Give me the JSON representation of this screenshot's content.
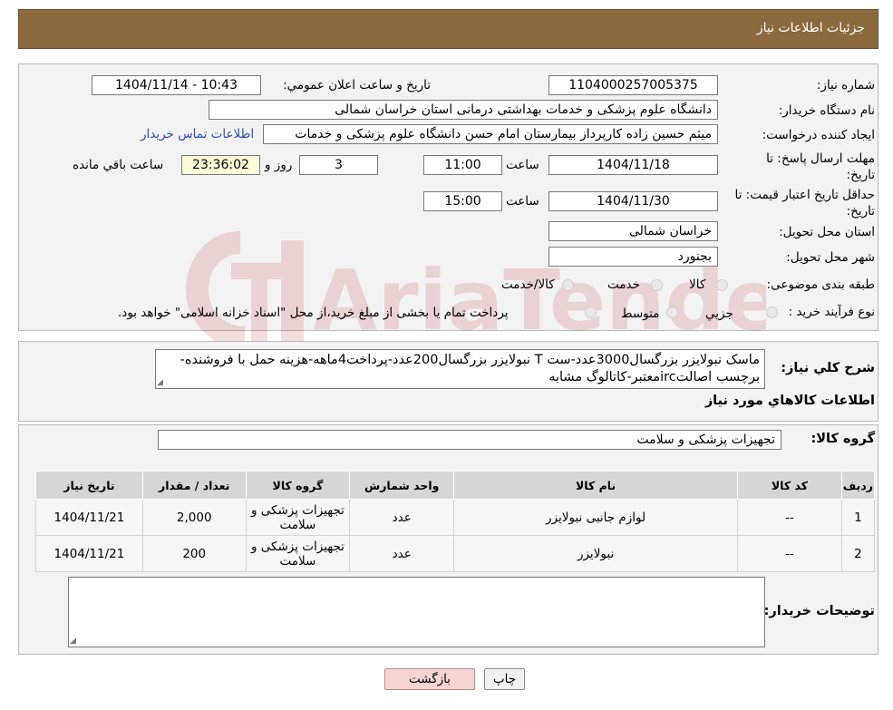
{
  "header": {
    "title": "جزئیات اطلاعات نیاز"
  },
  "form": {
    "need_number_label": "شماره نیاز:",
    "need_number": "1104000257005375",
    "announce_label": "تاریخ و ساعت اعلان عمومي:",
    "announce_value": "1404/11/14 - 10:43",
    "buyer_org_label": "نام دستگاه خريدار:",
    "buyer_org": "دانشگاه علوم پزشکی و خدمات بهداشتی درمانی استان خراسان شمالی",
    "requester_label": "ايجاد کننده درخواست:",
    "requester": "میثم  حسین زاده  کارپرداز بیمارستان امام حسن دانشگاه علوم پزشکی و خدمات",
    "contact_link": "اطلاعات تماس خريدار",
    "reply_deadline_label": "مهلت ارسال پاسخ: تا تاريخ:",
    "reply_date": "1404/11/18",
    "time_label": "ساعت",
    "reply_time": "11:00",
    "days_value": "3",
    "days_label": "روز و",
    "remaining_time": "23:36:02",
    "remaining_label": "ساعت باقي مانده",
    "validity_label": "حداقل تاريخ اعتبار قيمت: تا تاريخ:",
    "validity_date": "1404/11/30",
    "validity_time": "15:00",
    "province_label": "استان محل تحويل:",
    "province": "خراسان شمالی",
    "city_label": "شهر محل تحويل:",
    "city": "بجنورد",
    "category_label": "طبقه بندی موضوعی:",
    "category_options": [
      "کالا",
      "خدمت",
      "کالا/خدمت"
    ],
    "process_label": "نوع فرآيند خريد :",
    "process_options": [
      "جزيي",
      "متوسط"
    ],
    "process_note": "پرداخت تمام يا بخشی از مبلغ خريد،از محل \"اسناد خزانه اسلامی\" خواهد بود."
  },
  "description": {
    "label": "شرح کلي نياز:",
    "text": "ماسک نبولایزر بزرگسال3000عدد-ست T نبولایزر بزرگسال200عدد-پرداخت4ماهه-هزینه حمل با فروشنده-برچسب اصالتircمعتبر-کاتالوگ مشابه"
  },
  "goods": {
    "section_title": "اطلاعات کالاهاي مورد نياز",
    "group_label": "گروه کالا:",
    "group_value": "تجهیزات پزشکی و سلامت",
    "columns": [
      "رديف",
      "کد کالا",
      "نام کالا",
      "واحد شمارش",
      "گروه کالا",
      "تعداد / مقدار",
      "تاريخ نياز"
    ],
    "rows": [
      {
        "idx": "1",
        "code": "--",
        "name": "لوازم جانبی نبولایزر",
        "unit": "عدد",
        "group": "تجهیزات پزشکی و سلامت",
        "qty": "2,000",
        "date": "1404/11/21"
      },
      {
        "idx": "2",
        "code": "--",
        "name": "نبولایزر",
        "unit": "عدد",
        "group": "تجهیزات پزشکی و سلامت",
        "qty": "200",
        "date": "1404/11/21"
      }
    ]
  },
  "buyer_notes": {
    "label": "توضيحات خريدار:",
    "value": ""
  },
  "buttons": {
    "print": "چاپ",
    "back": "بازگشت"
  },
  "watermark": {
    "text": "AriaTender.neT"
  }
}
